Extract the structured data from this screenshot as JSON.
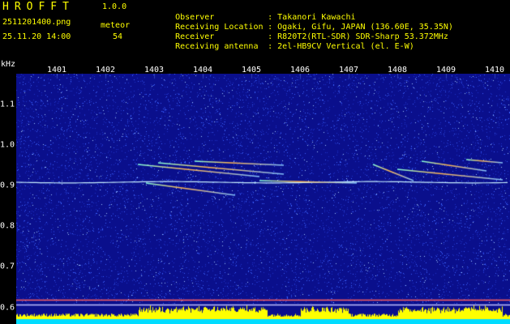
{
  "header": {
    "app_title": "HROFFT",
    "app_version": "1.0.0",
    "file_name": "2511201400.png",
    "timestamp": "25.11.20 14:00",
    "type_label": "meteor",
    "type_count": "54"
  },
  "station_info": [
    {
      "key": "Observer",
      "value": ": Takanori Kawachi"
    },
    {
      "key": "Receiving Location",
      "value": ": Ogaki, Gifu, JAPAN (136.60E, 35.35N)"
    },
    {
      "key": "Receiver",
      "value": ": R820T2(RTL-SDR) SDR-Sharp 53.372MHz"
    },
    {
      "key": "Receiving antenna",
      "value": ": 2el-HB9CV Vertical (el. E-W)"
    }
  ],
  "axes": {
    "y_unit": "kHz",
    "x_ticks": [
      "1401",
      "1402",
      "1403",
      "1404",
      "1405",
      "1406",
      "1407",
      "1408",
      "1409",
      "1410"
    ],
    "y_ticks": [
      "1.1",
      "1.0",
      "0.9",
      "0.8",
      "0.7",
      "0.6"
    ]
  },
  "colors": {
    "background": "#0a0f8c",
    "noise": "#3c64ff",
    "signal_hot": "#ffb450",
    "baseline": "#00dcff",
    "level_bar": "#ffff00",
    "text_yellow": "#ffff00",
    "text_white": "#ffffff"
  }
}
